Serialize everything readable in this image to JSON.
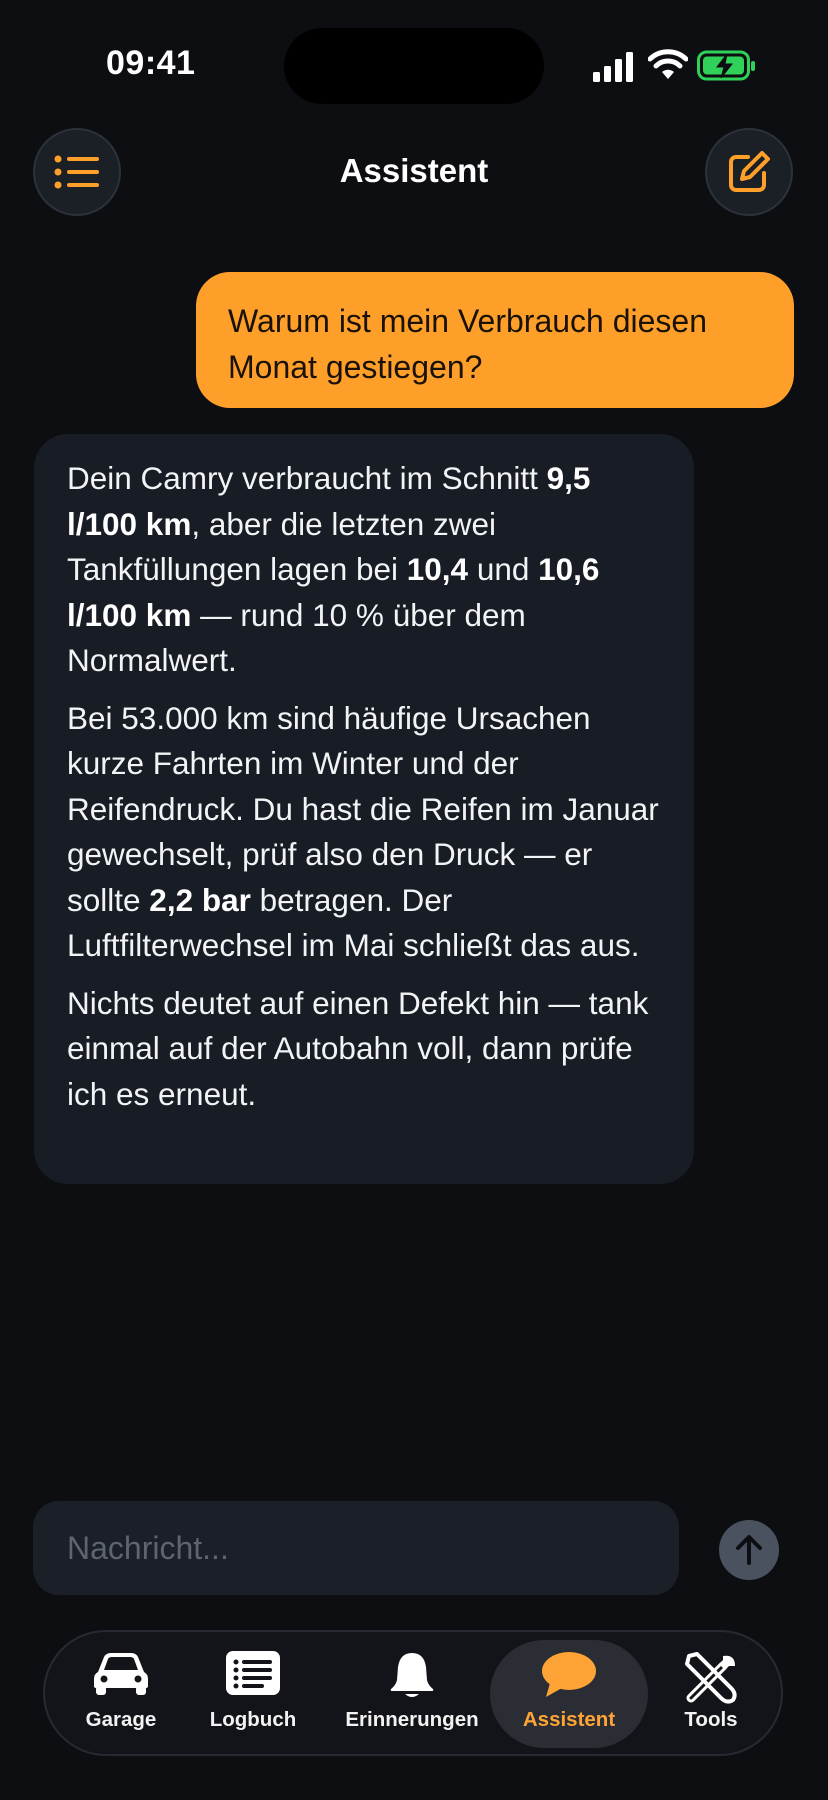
{
  "status_bar": {
    "time": "09:41"
  },
  "header": {
    "title": "Assistent",
    "menu_icon": "list-icon",
    "compose_icon": "compose-icon"
  },
  "colors": {
    "accent": "#fe9f2a",
    "background": "#0c0e12",
    "bubble": "#181c24"
  },
  "chat": {
    "user_message": "Warum ist mein Verbrauch diesen Monat gestiegen?",
    "assistant": {
      "p1": {
        "t1": "Dein Camry verbraucht im Schnitt ",
        "b1": "9,5 l/100 km",
        "t2": ", aber die letzten zwei Tankfüllungen lagen bei ",
        "b2": "10,4",
        "t3": " und ",
        "b3": "10,6 l/100 km",
        "t4": " — rund 10 % über dem Normalwert."
      },
      "p2": {
        "t1": "Bei 53.000 km sind häufige Ursachen kurze Fahrten im Winter und der Reifendruck. Du hast die Reifen im Januar gewechselt, prüf also den Druck — er sollte ",
        "b1": "2,2 bar",
        "t2": " betragen. Der Luftfilterwechsel im Mai schließt das aus."
      },
      "p3": "Nichts deutet auf einen Defekt hin — tank einmal auf der Autobahn voll, dann prüfe ich es erneut."
    }
  },
  "composer": {
    "placeholder": "Nachricht...",
    "send_icon": "arrow-up-icon"
  },
  "tabs": [
    {
      "label": "Garage",
      "icon": "car-icon",
      "active": false
    },
    {
      "label": "Logbuch",
      "icon": "list-icon",
      "active": false
    },
    {
      "label": "Erinnerungen",
      "icon": "bell-icon",
      "active": false
    },
    {
      "label": "Assistent",
      "icon": "chat-bubble-icon",
      "active": true
    },
    {
      "label": "Tools",
      "icon": "tools-icon",
      "active": false
    }
  ]
}
